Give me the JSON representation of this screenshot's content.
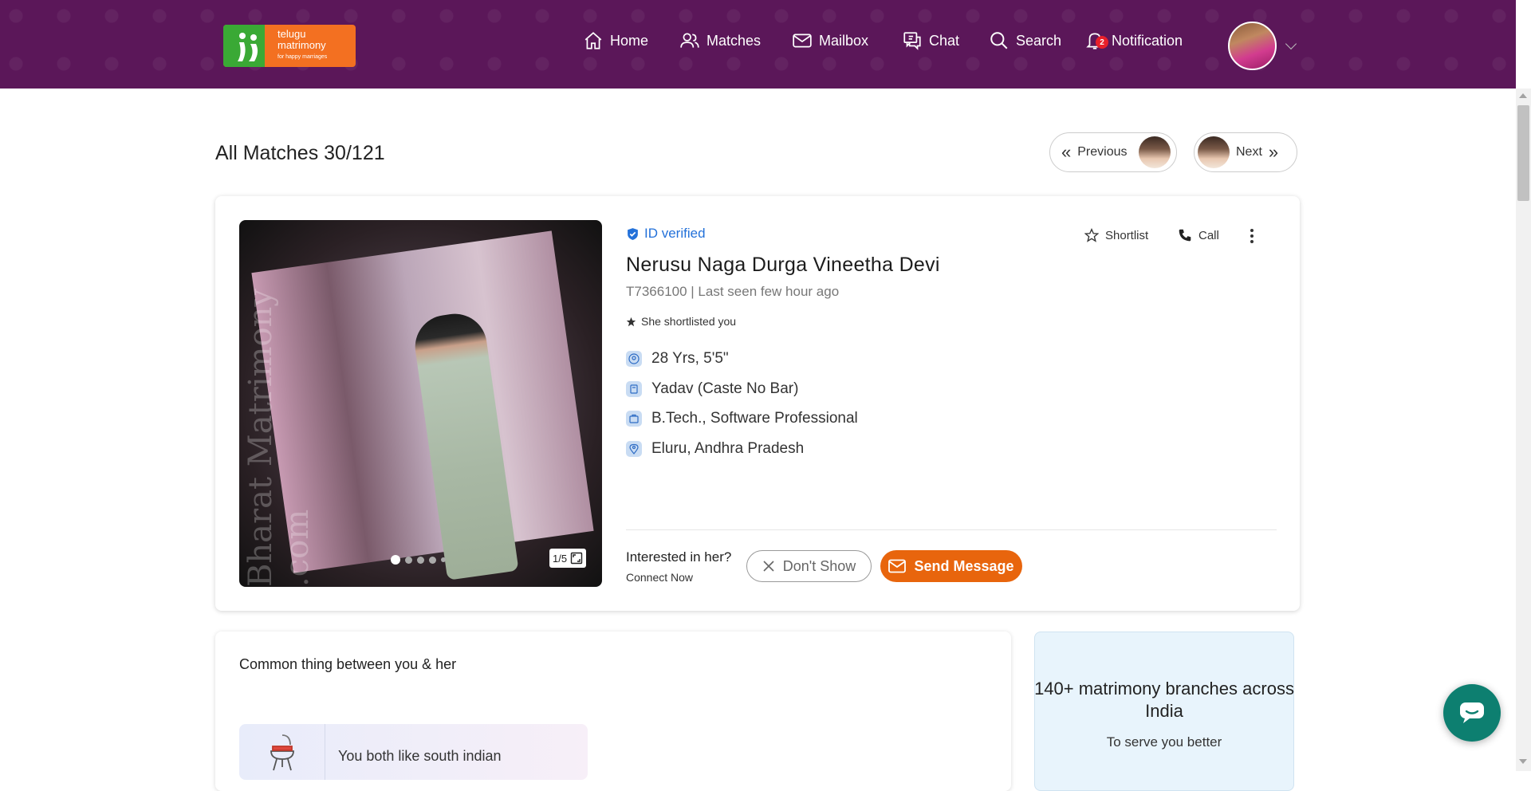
{
  "brand": {
    "logo_line1": "telugu",
    "logo_line2": "matrimony",
    "logo_tagline": "for happy marriages"
  },
  "nav": {
    "home": "Home",
    "matches": "Matches",
    "mailbox": "Mailbox",
    "chat": "Chat",
    "search": "Search",
    "notification": "Notification",
    "notification_count": "2"
  },
  "page": {
    "title": "All Matches 30/121",
    "previous_label": "Previous",
    "next_label": "Next"
  },
  "profile": {
    "verified_label": "ID verified",
    "name": "Nerusu Naga Durga Vineetha Devi",
    "id_and_seen": "T7366100 | Last seen few hour ago",
    "shortlisted_you": "She shortlisted you",
    "age_height": "28 Yrs, 5'5\"",
    "caste": "Yadav (Caste No Bar)",
    "education_job": "B.Tech., Software Professional",
    "location": "Eluru, Andhra Pradesh",
    "photo_counter": "1/5",
    "photo_watermark": "Bharat Matrimony .com",
    "shortlist_label": "Shortlist",
    "call_label": "Call",
    "interested_label": "Interested in her?",
    "connect_label": "Connect Now",
    "dont_show_label": "Don't Show",
    "send_message_label": "Send Message"
  },
  "common": {
    "title": "Common thing between you & her",
    "like_text": "You both like south indian"
  },
  "branches": {
    "title": "140+ matrimony branches across India",
    "subtitle": "To serve you better"
  },
  "colors": {
    "header": "#5b1759",
    "accent_orange": "#e8650d",
    "verified_blue": "#2371d9",
    "chat_fab": "#0d7f70"
  }
}
